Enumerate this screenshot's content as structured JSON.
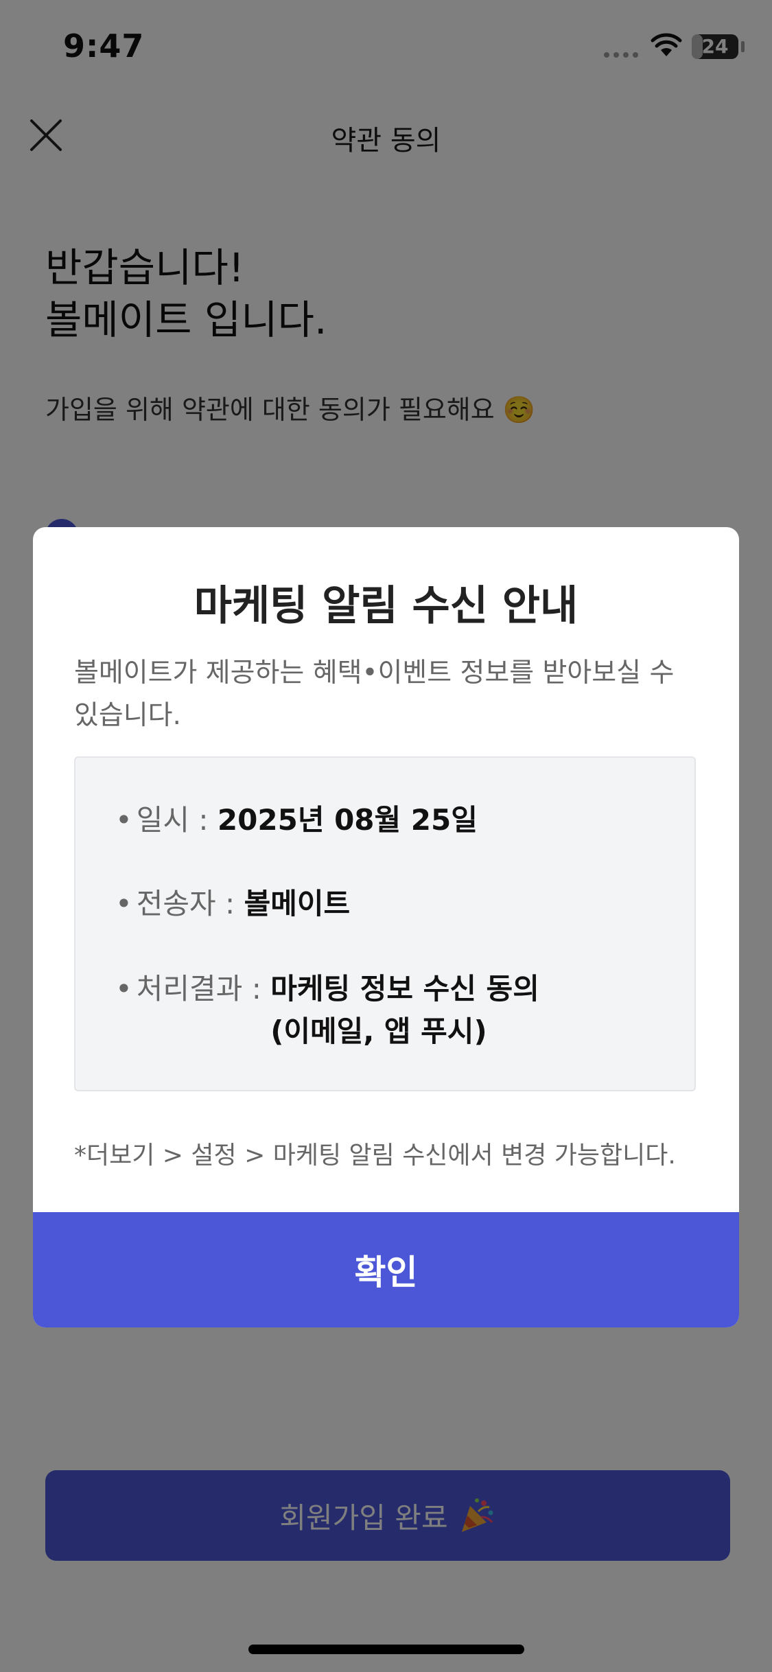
{
  "status_bar": {
    "time": "9:47",
    "battery_percent": 24,
    "battery_label": "24"
  },
  "header": {
    "title": "약관 동의",
    "close_icon": "close-icon"
  },
  "greeting": {
    "line1": "반갑습니다!",
    "line2": "볼메이트 입니다."
  },
  "subtitle": "가입을 위해 약관에 대한 동의가 필요해요 ☺️",
  "signup_button": {
    "label": "회원가입 완료",
    "icon": "party-popper-icon"
  },
  "modal": {
    "title": "마케팅 알림 수신 안내",
    "description": "볼메이트가 제공하는 혜택•이벤트 정보를 받아보실 수 있습니다.",
    "info": {
      "date": {
        "bullet": "•",
        "label": "일시 : ",
        "value": "2025년 08월 25일"
      },
      "sender": {
        "bullet": "•",
        "label": "전송자 : ",
        "value": "볼메이트"
      },
      "result": {
        "bullet": "•",
        "label": "처리결과 : ",
        "value_line1": "마케팅 정보 수신 동의",
        "value_line2": "(이메일, 앱 푸시)"
      }
    },
    "footnote": "*더보기 > 설정 > 마케팅 알림 수신에서 변경 가능합니다.",
    "confirm_label": "확인"
  },
  "colors": {
    "accent": "#4b57d6",
    "overlay": "rgba(0,0,0,0.5)",
    "info_box_bg": "#f3f4f6"
  }
}
